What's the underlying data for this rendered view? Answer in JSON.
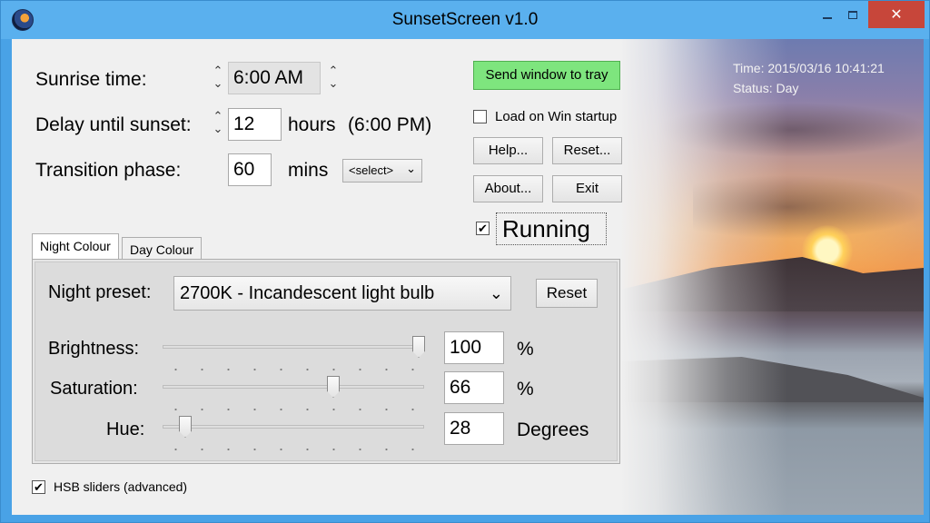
{
  "window": {
    "title": "SunsetScreen v1.0",
    "close_glyph": "✕"
  },
  "schedule": {
    "sunrise_label": "Sunrise time:",
    "sunrise_value": "6:00 AM",
    "delay_label": "Delay until sunset:",
    "delay_value": "12",
    "delay_unit": "hours",
    "delay_result": "(6:00 PM)",
    "transition_label": "Transition phase:",
    "transition_value": "60",
    "transition_unit": "mins",
    "transition_select": "<select>"
  },
  "actions": {
    "send_to_tray": "Send window to tray",
    "load_on_startup": "Load on Win startup",
    "load_on_startup_checked": false,
    "help": "Help...",
    "reset": "Reset...",
    "about": "About...",
    "exit": "Exit",
    "running_label": "Running",
    "running_checked": true
  },
  "status": {
    "time_line": "Time: 2015/03/16 10:41:21",
    "status_line": "Status: Day"
  },
  "tabs": [
    {
      "label": "Night Colour",
      "active": true
    },
    {
      "label": "Day Colour",
      "active": false
    }
  ],
  "night": {
    "preset_label": "Night preset:",
    "preset_value": "2700K - Incandescent light bulb",
    "reset_label": "Reset",
    "brightness_label": "Brightness:",
    "brightness_value": "100",
    "brightness_unit": "%",
    "saturation_label": "Saturation:",
    "saturation_value": "66",
    "saturation_unit": "%",
    "hue_label": "Hue:",
    "hue_value": "28",
    "hue_unit": "Degrees"
  },
  "footer": {
    "hsb_label": "HSB sliders (advanced)",
    "hsb_checked": true
  },
  "icons": {
    "spin_up": "⌃",
    "spin_down": "⌄",
    "dropdown": "⌄",
    "check": "✔"
  }
}
